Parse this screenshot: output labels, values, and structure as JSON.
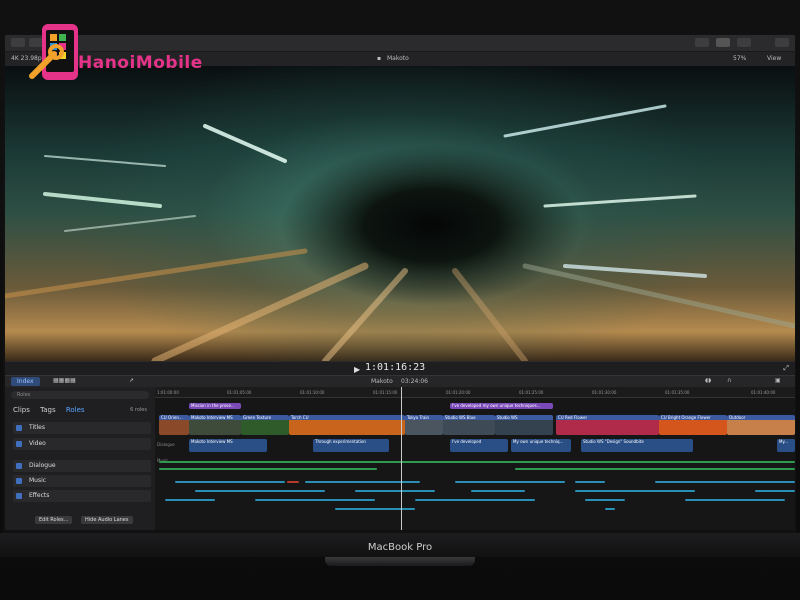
{
  "watermark": {
    "text": "HanoiMobile"
  },
  "viewer": {
    "format": "4K 23.98p",
    "title": "Makoto",
    "zoom": "57%",
    "view_label": "View"
  },
  "controls": {
    "timecode": "1:01:16:23"
  },
  "timeline_toolbar": {
    "index_label": "Index",
    "project": "Makoto",
    "duration": "03:24:06"
  },
  "index_panel": {
    "search_placeholder": "Roles",
    "tabs": [
      "Clips",
      "Tags",
      "Roles"
    ],
    "roles_count": "6 roles",
    "roles": [
      "Titles",
      "Video",
      "Dialogue",
      "Music",
      "Effects"
    ],
    "edit_roles": "Edit Roles...",
    "hide_lanes": "Hide Audio Lanes"
  },
  "ruler": [
    "1:01:00:00",
    "01:01:05:00",
    "01:01:10:00",
    "01:01:15:00",
    "01:01:20:00",
    "01:01:25:00",
    "01:01:30:00",
    "01:01:35:00",
    "01:01:40:00"
  ],
  "connected_titles": [
    "Mission in the prose...",
    "I've developed my own unique techniques..."
  ],
  "primary_clips": [
    "CU Orien...",
    "Makoto Interview MS",
    "Green Texture",
    "Torch CU",
    "Tokyo Train",
    "Studio WS Blue",
    "Studio WS",
    "CU Red Flower",
    "CU Bright Orange Flower",
    "Outdoor"
  ],
  "audio_clips": [
    "Makoto Interview MS",
    "Through experimentation",
    "I've developed",
    "My own unique techniq...",
    "Studio WS \"Design\" Soundbite",
    "My..."
  ],
  "lane_labels": {
    "dialogue": "Dialogue",
    "music": "Music"
  },
  "device_label": "MacBook Pro",
  "colors": {
    "accent": "#5aa3ff",
    "title_clip": "#7a4ab8",
    "audio_clip": "#2a4f86",
    "music_line": "#2f9a4f",
    "effect_line": "#2a8fb5",
    "watermark": "#e6338a"
  }
}
